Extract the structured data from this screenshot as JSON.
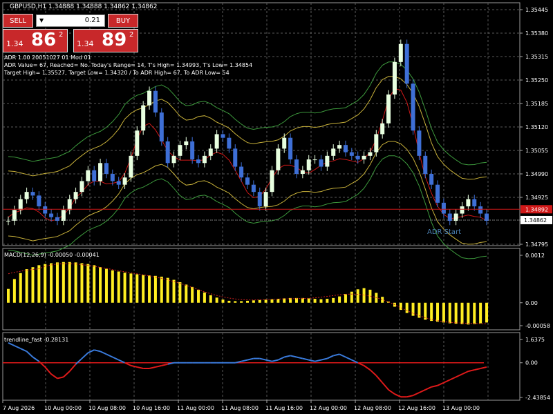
{
  "window": {
    "title": "GBPUSD,H1  1.34888 1.34888 1.34862 1.34862"
  },
  "trade": {
    "sell_label": "SELL",
    "buy_label": "BUY",
    "lot": "0.21",
    "sell_price_prefix": "1.34",
    "sell_price_big": "86",
    "sell_price_sup": "2",
    "buy_price_prefix": "1.34",
    "buy_price_big": "89",
    "buy_price_sup": "2"
  },
  "adr_info": {
    "line1": "ADR 1.00 20051027 01 Mod 01",
    "line2": "ADR Value= 67, Reached= No. Today's Range= 14, T's High= 1.34993, T's Low= 1.34854",
    "line3": "Target High= 1.35527, Target Low= 1.34320 / To ADR High= 67, To ADR Low= 54",
    "start_label": "ADR Start"
  },
  "price_axis": {
    "ticks": [
      "1.35445",
      "1.35380",
      "1.35315",
      "1.35250",
      "1.35185",
      "1.35120",
      "1.35055",
      "1.34990",
      "1.34925",
      "1.34862",
      "1.34795"
    ],
    "red_line_label": "1.34892",
    "current_label": "1.34862"
  },
  "macd": {
    "label": "MACD(12,26,9) -0.00050 -0.00041",
    "ticks": [
      "0.0012",
      "0.00",
      "-0.00058"
    ]
  },
  "trendline": {
    "label": "trendline_fast -0.28131",
    "ticks": [
      "1.6375",
      "0.00",
      "-2.43854"
    ]
  },
  "time_axis": {
    "labels": [
      "7 Aug 2026",
      "10 Aug 00:00",
      "10 Aug 08:00",
      "10 Aug 16:00",
      "11 Aug 00:00",
      "11 Aug 08:00",
      "11 Aug 16:00",
      "12 Aug 00:00",
      "12 Aug 08:00",
      "12 Aug 16:00",
      "13 Aug 00:00"
    ]
  },
  "colors": {
    "background": "#000000",
    "grid": "#5a5a5a",
    "bull_candle": "#e8ffe0",
    "bear_candle": "#3e6fd6",
    "macd_hist": "#ffee22",
    "macd_signal": "#d02020",
    "envelope_outer": "#3d9a3d",
    "envelope_inner": "#c9b23a",
    "ma_red": "#d01818",
    "trend_blue": "#3a7bdc",
    "trend_red": "#e01a1a"
  },
  "chart_data": [
    {
      "type": "candlestick",
      "symbol": "GBPUSD",
      "timeframe": "H1",
      "ylim": [
        1.34795,
        1.35445
      ],
      "close": [
        1.3486,
        1.3489,
        1.3492,
        1.3494,
        1.3493,
        1.349,
        1.3488,
        1.3487,
        1.3486,
        1.3489,
        1.3492,
        1.3494,
        1.3497,
        1.35,
        1.3497,
        1.3502,
        1.3499,
        1.3497,
        1.3496,
        1.3498,
        1.3504,
        1.3511,
        1.3518,
        1.3522,
        1.3516,
        1.3508,
        1.3502,
        1.3504,
        1.3507,
        1.3508,
        1.3503,
        1.3502,
        1.3504,
        1.3506,
        1.351,
        1.3509,
        1.3506,
        1.3501,
        1.3498,
        1.3496,
        1.3494,
        1.349,
        1.3494,
        1.35,
        1.3506,
        1.3509,
        1.3503,
        1.3499,
        1.35,
        1.3503,
        1.3503,
        1.3501,
        1.3504,
        1.3506,
        1.3507,
        1.3505,
        1.3504,
        1.3503,
        1.3504,
        1.3505,
        1.351,
        1.3513,
        1.3521,
        1.353,
        1.3535,
        1.3524,
        1.3511,
        1.3504,
        1.3499,
        1.3496,
        1.3491,
        1.3488,
        1.3486,
        1.3488,
        1.349,
        1.3492,
        1.349,
        1.3488,
        1.3486
      ]
    },
    {
      "type": "bar",
      "name": "MACD(12,26,9)",
      "ylim": [
        -0.00058,
        0.0012
      ],
      "values": [
        0.00035,
        0.0006,
        0.00075,
        0.00085,
        0.0009,
        0.00095,
        0.00098,
        0.001,
        0.00102,
        0.00103,
        0.00103,
        0.00102,
        0.001,
        0.00098,
        0.00095,
        0.0009,
        0.00086,
        0.00082,
        0.00079,
        0.00076,
        0.00074,
        0.00072,
        0.0007,
        0.00069,
        0.00068,
        0.00066,
        0.00063,
        0.00058,
        0.00052,
        0.00046,
        0.0004,
        0.00033,
        0.00026,
        0.00019,
        0.00013,
        8e-05,
        5e-05,
        4e-05,
        4e-05,
        5e-05,
        6e-05,
        7e-05,
        8e-05,
        9e-05,
        0.0001,
        0.00011,
        0.00012,
        0.00012,
        0.00012,
        0.00011,
        0.0001,
        9e-05,
        0.0001,
        0.00012,
        0.00016,
        0.00022,
        0.00028,
        0.00034,
        0.00037,
        0.00033,
        0.00025,
        0.00015,
        3e-05,
        -0.0001,
        -0.00018,
        -0.00026,
        -0.00033,
        -0.00038,
        -0.00043,
        -0.00046,
        -0.00048,
        -0.0005,
        -0.00052,
        -0.00053,
        -0.00054,
        -0.00055,
        -0.00054,
        -0.00052,
        -0.0005
      ]
    },
    {
      "type": "line",
      "name": "trendline_fast",
      "ylim": [
        -2.43854,
        1.6375
      ],
      "series": [
        {
          "values": [
            1.4,
            1.2,
            1.0,
            0.8,
            0.4,
            0.1,
            -0.3,
            -0.8,
            -1.1,
            -1.0,
            -0.6,
            -0.1,
            0.3,
            0.7,
            0.9,
            0.8,
            0.6,
            0.4,
            0.2,
            0.0,
            -0.2,
            -0.3,
            -0.4,
            -0.4,
            -0.3,
            -0.2,
            -0.1,
            0.0,
            0.0,
            0.0,
            0.0,
            0.0,
            0.0,
            0.0,
            0.0,
            0.0,
            0.0,
            0.0,
            0.1,
            0.2,
            0.3,
            0.3,
            0.2,
            0.1,
            0.2,
            0.4,
            0.5,
            0.4,
            0.3,
            0.2,
            0.1,
            0.2,
            0.3,
            0.5,
            0.6,
            0.4,
            0.2,
            0.0,
            -0.2,
            -0.5,
            -0.9,
            -1.4,
            -1.9,
            -2.2,
            -2.4,
            -2.4,
            -2.3,
            -2.1,
            -1.9,
            -1.7,
            -1.6,
            -1.4,
            -1.2,
            -1.0,
            -0.8,
            -0.6,
            -0.5,
            -0.4,
            -0.3
          ]
        }
      ]
    }
  ]
}
